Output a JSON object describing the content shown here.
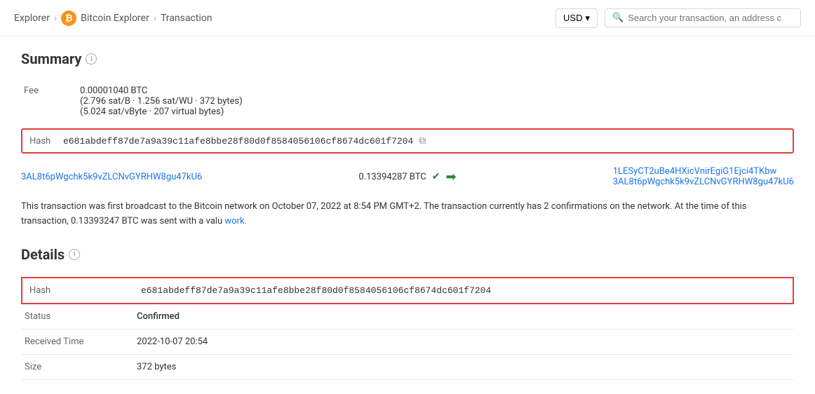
{
  "header": {
    "breadcrumb": {
      "explorer_label": "Explorer",
      "bitcoin_explorer_label": "Bitcoin Explorer",
      "page_label": "Transaction"
    },
    "currency": {
      "selected": "USD",
      "dropdown_icon": "▾"
    },
    "search": {
      "placeholder": "Search your transaction, an address c"
    }
  },
  "summary": {
    "heading": "Summary",
    "fee_label": "Fee",
    "fee_line1": "0.00001040 BTC",
    "fee_line2": "(2.796 sat/B · 1.256 sat/WU · 372 bytes)",
    "fee_line3": "(5.024 sat/vByte · 207 virtual bytes)",
    "hash_label": "Hash",
    "hash_value": "e681abdeff87de7a9a39c11afe8bbe28f80d0f8584056106cf8674dc601f7204",
    "copy_label": "⧉",
    "tx_flow": {
      "from_address": "3AL8t6pWgchk5k9vZLCNvGYRHW8gu47kU6",
      "amount": "0.13394287 BTC",
      "to_address1": "1LESyCT2uBe4HXicVnirEgiG1Ejci4TKbw",
      "to_address2": "3AL8t6pWgchk5k9vZLCNvGYRHW8gu47kU6"
    },
    "description": "This transaction was first broadcast to the Bitcoin network on October 07, 2022 at 8:54 PM GMT+2.  The transaction currently has 2 confirmations on the network.  At the time of this transaction, 0.13393247 BTC was sent with a valu",
    "description_link": "work."
  },
  "details": {
    "heading": "Details",
    "rows": [
      {
        "label": "Hash",
        "value": "e681abdeff87de7a9a39c11afe8bbe28f80d0f8584056106cf8674dc601f7204",
        "highlighted": true
      },
      {
        "label": "Status",
        "value": "Confirmed",
        "status": "confirmed"
      },
      {
        "label": "Received Time",
        "value": "2022-10-07 20:54"
      },
      {
        "label": "Size",
        "value": "372 bytes"
      }
    ]
  },
  "icons": {
    "btc_symbol": "₿",
    "search_symbol": "🔍",
    "arrow_right": "➡",
    "info": "i",
    "copy": "⧉",
    "chevron_down": "▾",
    "check_circle": "✔"
  }
}
